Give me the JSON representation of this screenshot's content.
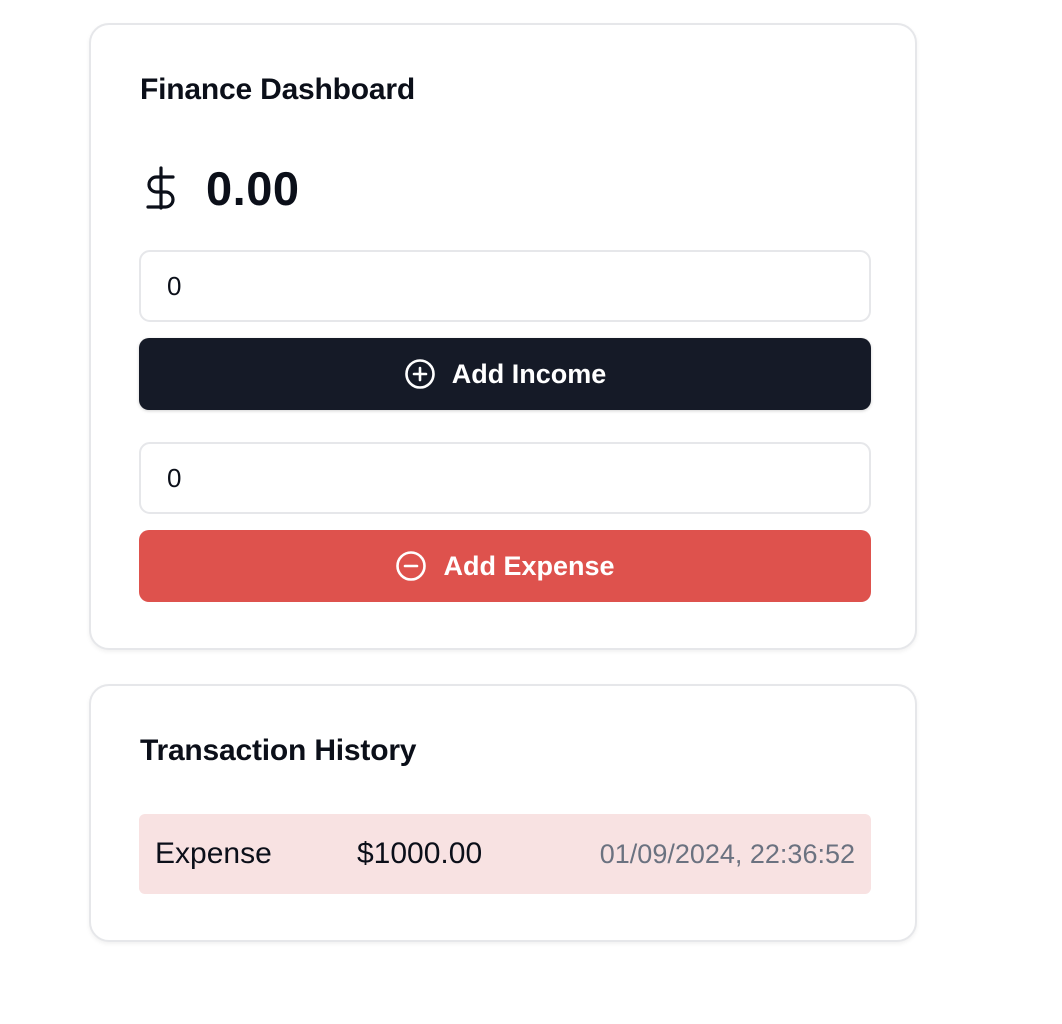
{
  "dashboard": {
    "title": "Finance Dashboard",
    "balance": "0.00",
    "currency_icon": "dollar-sign-icon",
    "income_input_value": "0",
    "income_button_label": "Add Income",
    "income_icon": "plus-circle-icon",
    "expense_input_value": "0",
    "expense_button_label": "Add Expense",
    "expense_icon": "minus-circle-icon"
  },
  "history": {
    "title": "Transaction History",
    "transactions": [
      {
        "type": "Expense",
        "amount": "$1000.00",
        "datetime": "01/09/2024, 22:36:52"
      }
    ]
  },
  "colors": {
    "primary_button": "#151a27",
    "expense_button": "#de524d",
    "expense_row_bg": "#f8e2e2",
    "muted_text": "#6b7280",
    "border": "#e6e7ea"
  }
}
